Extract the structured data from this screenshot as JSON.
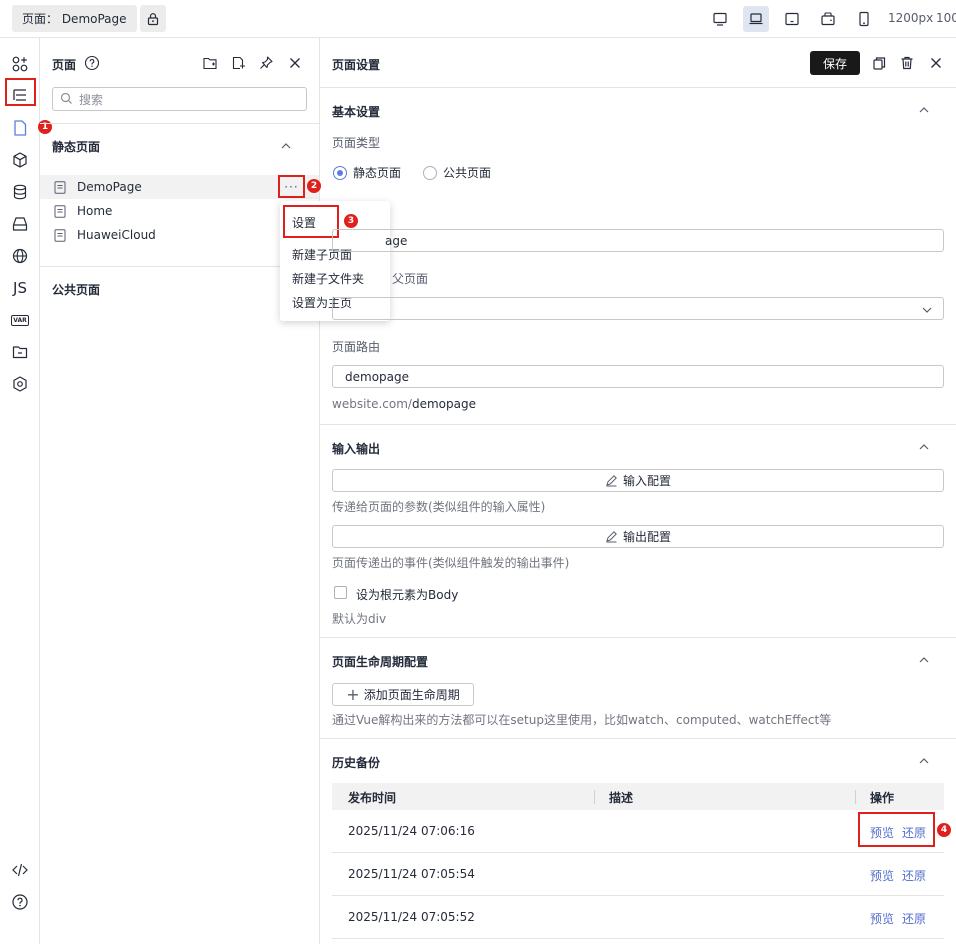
{
  "topbar": {
    "page_chip": "页面： DemoPage",
    "width_label": "1200px",
    "zoom_label": "100",
    "devices": [
      "desktop-icon",
      "laptop-icon",
      "tablet-landscape-icon",
      "tablet-rotate-icon",
      "mobile-icon"
    ]
  },
  "rail": {
    "icons": [
      "components-icon",
      "outline-icon",
      "page-icon",
      "block-icon",
      "datasource-icon",
      "storage-icon",
      "globe-icon",
      "js-icon",
      "var-icon",
      "folder-icon",
      "plugin-icon",
      "code-icon",
      "help-icon"
    ],
    "js_text": "JS",
    "var_text": "VAR"
  },
  "badges": [
    "1",
    "2",
    "3",
    "4"
  ],
  "panel": {
    "title": "页面",
    "search_placeholder": "搜索",
    "static_group": "静态页面",
    "public_group": "公共页面",
    "pages": [
      "DemoPage",
      "Home",
      "HuaweiCloud"
    ],
    "more_label": "···"
  },
  "context_menu": {
    "items": [
      "设置",
      "新建子页面",
      "新建子文件夹",
      "设置为主页"
    ]
  },
  "settings": {
    "title": "页面设置",
    "save_label": "保存",
    "basic": {
      "title": "基本设置",
      "type_label": "页面类型",
      "radio_static": "静态页面",
      "radio_public": "公共页面",
      "name_value": "age",
      "parent_label": "父页面",
      "route_label": "页面路由",
      "route_value": "demopage",
      "route_prefix": "website.com/",
      "route_suffix": "demopage"
    },
    "io": {
      "title": "输入输出",
      "input_btn": "输入配置",
      "input_help": "传递给页面的参数(类似组件的输入属性)",
      "output_btn": "输出配置",
      "output_help": "页面传递出的事件(类似组件触发的输出事件)",
      "body_check": "设为根元素为Body",
      "body_help": "默认为div"
    },
    "lifecycle": {
      "title": "页面生命周期配置",
      "add_btn": "添加页面生命周期",
      "help": "通过Vue解构出来的方法都可以在setup这里使用，比如watch、computed、watchEffect等"
    },
    "history": {
      "title": "历史备份",
      "columns": [
        "发布时间",
        "描述",
        "操作"
      ],
      "rows": [
        {
          "time": "2025/11/24 07:06:16",
          "preview": "预览",
          "restore": "还原"
        },
        {
          "time": "2025/11/24 07:05:54",
          "preview": "预览",
          "restore": "还原"
        },
        {
          "time": "2025/11/24 07:05:52",
          "preview": "预览",
          "restore": "还原"
        }
      ]
    }
  },
  "colors": {
    "accent": "#5e7ce0",
    "highlight_red": "#e0201c",
    "link": "#526ecc",
    "save_bg": "#191919"
  }
}
